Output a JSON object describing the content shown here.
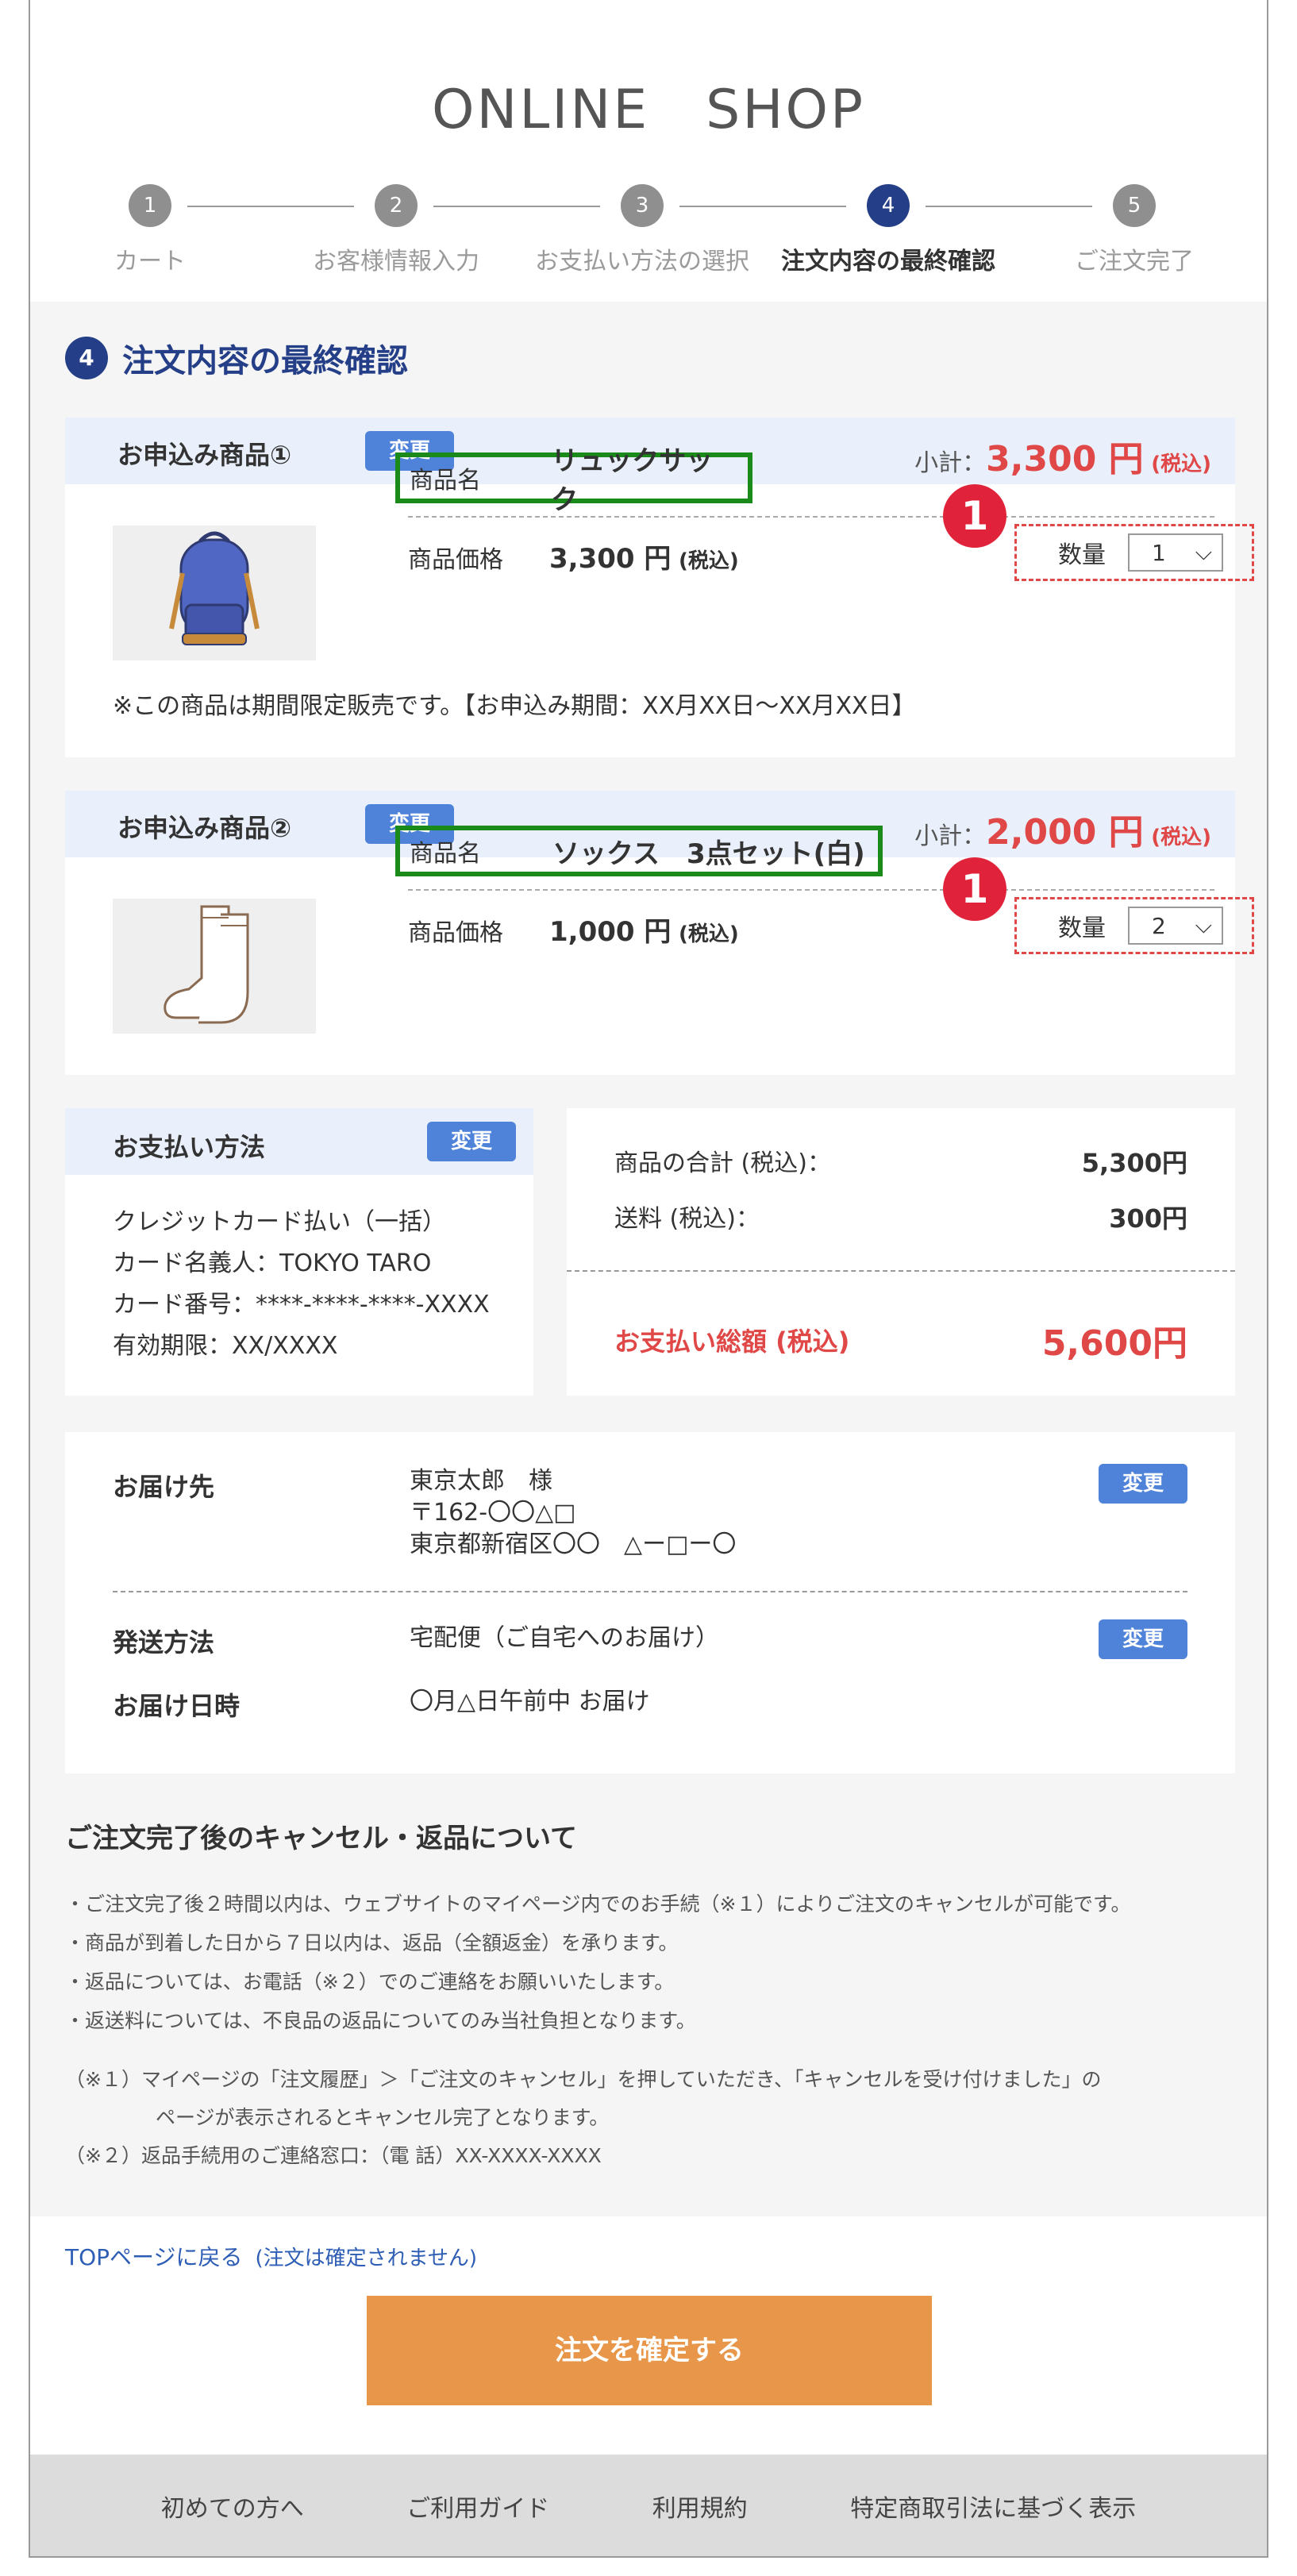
{
  "shop_title": "ONLINE　SHOP",
  "steps": [
    {
      "num": "1",
      "label": "カート"
    },
    {
      "num": "2",
      "label": "お客様情報入力"
    },
    {
      "num": "3",
      "label": "お支払い方法の選択"
    },
    {
      "num": "4",
      "label": "注文内容の最終確認"
    },
    {
      "num": "5",
      "label": "ご注文完了"
    }
  ],
  "section": {
    "num": "4",
    "title": "注文内容の最終確認"
  },
  "change_label": "変更",
  "badge_label": "1",
  "items": [
    {
      "heading": "お申込み商品①",
      "subtotal_label": "小計：",
      "subtotal_value": "3,300 円",
      "subtotal_tax": "(税込)",
      "image_icon": "backpack-icon",
      "name_key": "商品名",
      "name_value": "リュックサック",
      "price_key": "商品価格",
      "price_value": "3,300 円",
      "price_tax": "(税込)",
      "qty_key": "数量",
      "qty_value": "1",
      "note": "※この商品は期間限定販売です。【お申込み期間：XX月XX日〜XX月XX日】"
    },
    {
      "heading": "お申込み商品②",
      "subtotal_label": "小計：",
      "subtotal_value": "2,000 円",
      "subtotal_tax": "(税込)",
      "image_icon": "socks-icon",
      "name_key": "商品名",
      "name_value": "ソックス　3点セット(白)",
      "price_key": "商品価格",
      "price_value": "1,000 円",
      "price_tax": "(税込)",
      "qty_key": "数量",
      "qty_value": "2"
    }
  ],
  "payment": {
    "title": "お支払い方法",
    "lines": [
      "クレジットカード払い（一括）",
      "カード名義人：TOKYO TARO",
      "カード番号：****-****-****-XXXX",
      "有効期限：XX/XXXX"
    ]
  },
  "totals": {
    "goods_label": "商品の合計 (税込)：",
    "goods_value": "5,300円",
    "shipping_label": "送料 (税込)：",
    "shipping_value": "300円",
    "total_label": "お支払い総額 (税込)",
    "total_value": "5,600円"
  },
  "shipping": {
    "dest_label": "お届け先",
    "dest_name": "東京太郎　様",
    "dest_zip": "〒162-〇〇△□",
    "dest_addr": "東京都新宿区〇〇　△ー□ー〇",
    "method_label": "発送方法",
    "method_value": "宅配便（ご自宅へのお届け）",
    "date_label": "お届け日時",
    "date_value": "〇月△日午前中 お届け"
  },
  "cancel": {
    "title": "ご注文完了後のキャンセル・返品について",
    "items": [
      "・ご注文完了後２時間以内は、ウェブサイトのマイページ内でのお手続（※１）によりご注文のキャンセルが可能です。",
      "・商品が到着した日から７日以内は、返品（全額返金）を承ります。",
      "・返品については、お電話（※２）でのご連絡をお願いいたします。",
      "・返送料については、不良品の返品についてのみ当社負担となります。"
    ],
    "note1_a": "（※１）マイページの「注文履歴」＞「ご注文のキャンセル」を押していただき、「キャンセルを受け付けました」の",
    "note1_b": "ページが表示されるとキャンセル完了となります。",
    "note2": "（※２）返品手続用のご連絡窓口：（電 話）XX-XXXX-XXXX"
  },
  "top_link": "TOPページに戻る",
  "top_link_note": "(注文は確定されません)",
  "confirm_button": "注文を確定する",
  "footer": [
    "初めての方へ",
    "ご利用ガイド",
    "利用規約",
    "特定商取引法に基づく表示"
  ]
}
